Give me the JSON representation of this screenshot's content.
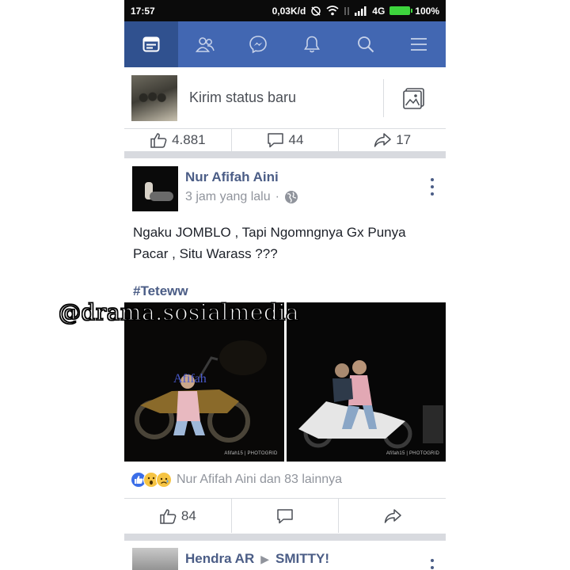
{
  "status_bar": {
    "time": "17:57",
    "network_speed": "0,03K/d",
    "network_type": "4G",
    "battery": "100%"
  },
  "nav": {
    "active_color": "#30518f",
    "bar_color": "#4267b2",
    "items": [
      {
        "icon": "news-feed-icon",
        "active": true
      },
      {
        "icon": "friends-icon",
        "active": false
      },
      {
        "icon": "messenger-icon",
        "active": false
      },
      {
        "icon": "notifications-icon",
        "active": false
      },
      {
        "icon": "search-icon",
        "active": false
      },
      {
        "icon": "menu-icon",
        "active": false
      }
    ]
  },
  "composer": {
    "placeholder": "Kirim status baru",
    "photo_icon": "photo-icon"
  },
  "prev_post_actions": {
    "likes": "4.881",
    "comments": "44",
    "shares": "17"
  },
  "post": {
    "author": "Nur Afifah Aini",
    "time": "3 jam yang lalu",
    "separator": "·",
    "privacy_icon": "globe-icon",
    "text": "Ngaku JOMBLO , Tapi Ngomngnya Gx Punya Pacar , Situ Warass ???",
    "hashtag": "#Teteww",
    "photo_left_overlay": "Afifah",
    "photo_left_watermark": "Afifah15 | PHOTOGRID",
    "photo_right_watermark": "Afifah15 | PHOTOGRID",
    "reactions_text": "Nur Afifah Aini dan 83 lainnya",
    "likes": "84"
  },
  "overlay_watermark": "@drama.sosialmedia",
  "next_post": {
    "author": "Hendra AR",
    "arrow": "▶",
    "target": "SMITTY!"
  }
}
